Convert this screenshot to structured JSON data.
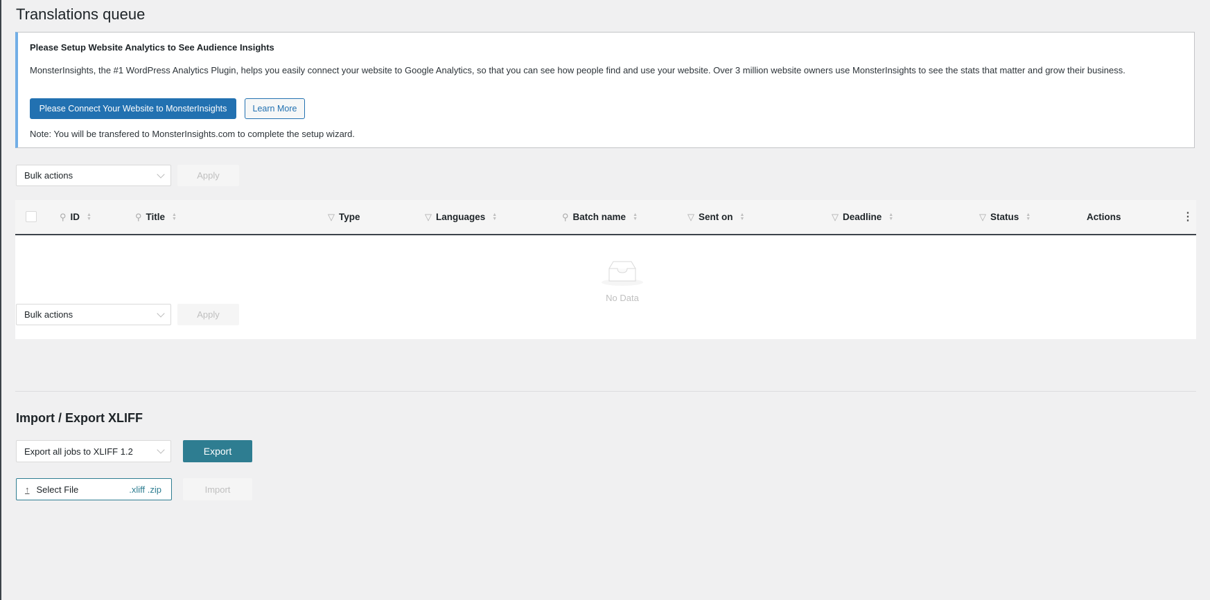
{
  "page": {
    "title": "Translations queue"
  },
  "notice": {
    "title": "Please Setup Website Analytics to See Audience Insights",
    "body": "MonsterInsights, the #1 WordPress Analytics Plugin, helps you easily connect your website to Google Analytics, so that you can see how people find and use your website. Over 3 million website owners use MonsterInsights to see the stats that matter and grow their business.",
    "connect_label": "Please Connect Your Website to MonsterInsights",
    "learn_more_label": "Learn More",
    "note": "Note: You will be transfered to MonsterInsights.com to complete the setup wizard."
  },
  "bulk": {
    "select_value": "Bulk actions",
    "apply_label": "Apply"
  },
  "table": {
    "columns": [
      "ID",
      "Title",
      "Type",
      "Languages",
      "Batch name",
      "Sent on",
      "Deadline",
      "Status",
      "Actions"
    ],
    "empty_text": "No Data"
  },
  "xliff": {
    "heading": "Import / Export XLIFF",
    "export_select_value": "Export all jobs to XLIFF 1.2",
    "export_label": "Export",
    "select_file_label": "Select File",
    "file_types": ".xliff .zip",
    "import_label": "Import"
  }
}
